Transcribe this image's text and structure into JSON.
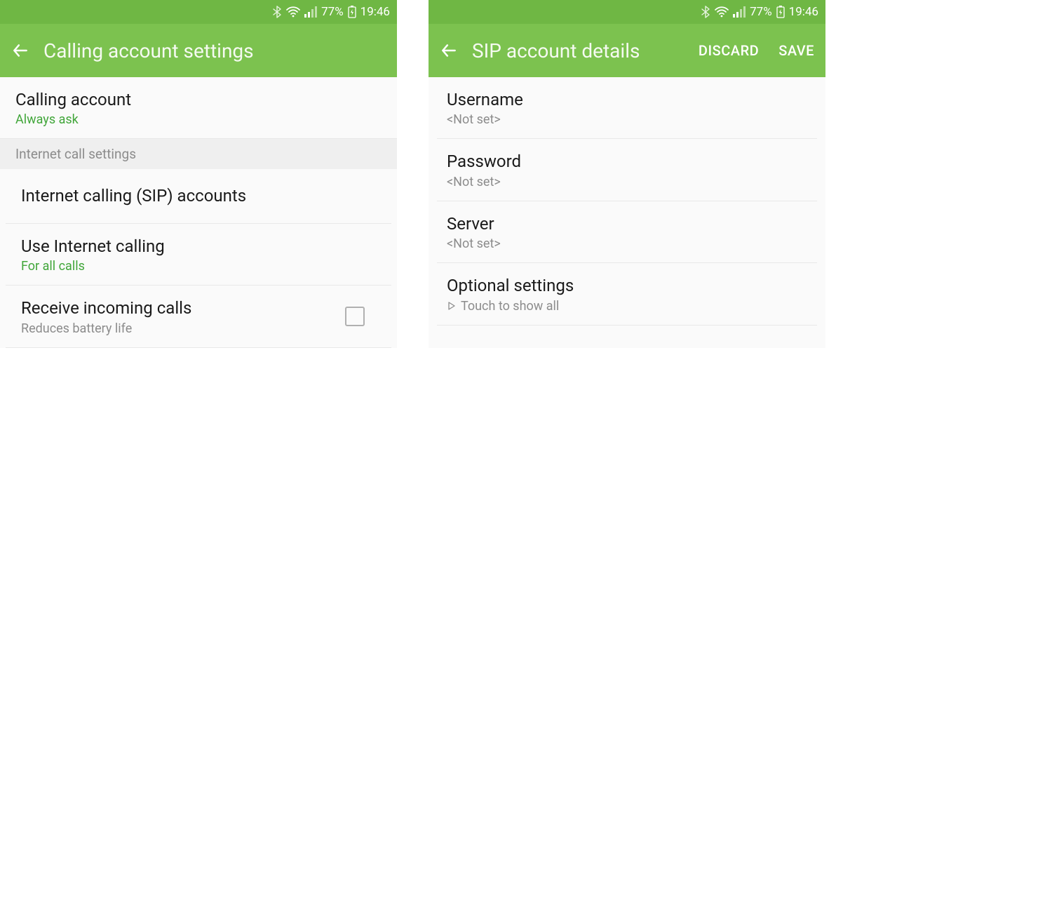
{
  "status": {
    "battery_pct": "77%",
    "time": "19:46"
  },
  "left": {
    "title": "Calling account settings",
    "calling_account": {
      "label": "Calling account",
      "value": "Always ask"
    },
    "section_internet": "Internet call settings",
    "sip_accounts": {
      "label": "Internet calling (SIP) accounts"
    },
    "use_internet": {
      "label": "Use Internet calling",
      "value": "For all calls"
    },
    "receive_incoming": {
      "label": "Receive incoming calls",
      "sub": "Reduces battery life"
    }
  },
  "right": {
    "title": "SIP account details",
    "discard": "DISCARD",
    "save": "SAVE",
    "username": {
      "label": "Username",
      "value": "<Not set>"
    },
    "password": {
      "label": "Password",
      "value": "<Not set>"
    },
    "server": {
      "label": "Server",
      "value": "<Not set>"
    },
    "optional": {
      "label": "Optional settings",
      "sub": "Touch to show all"
    }
  }
}
